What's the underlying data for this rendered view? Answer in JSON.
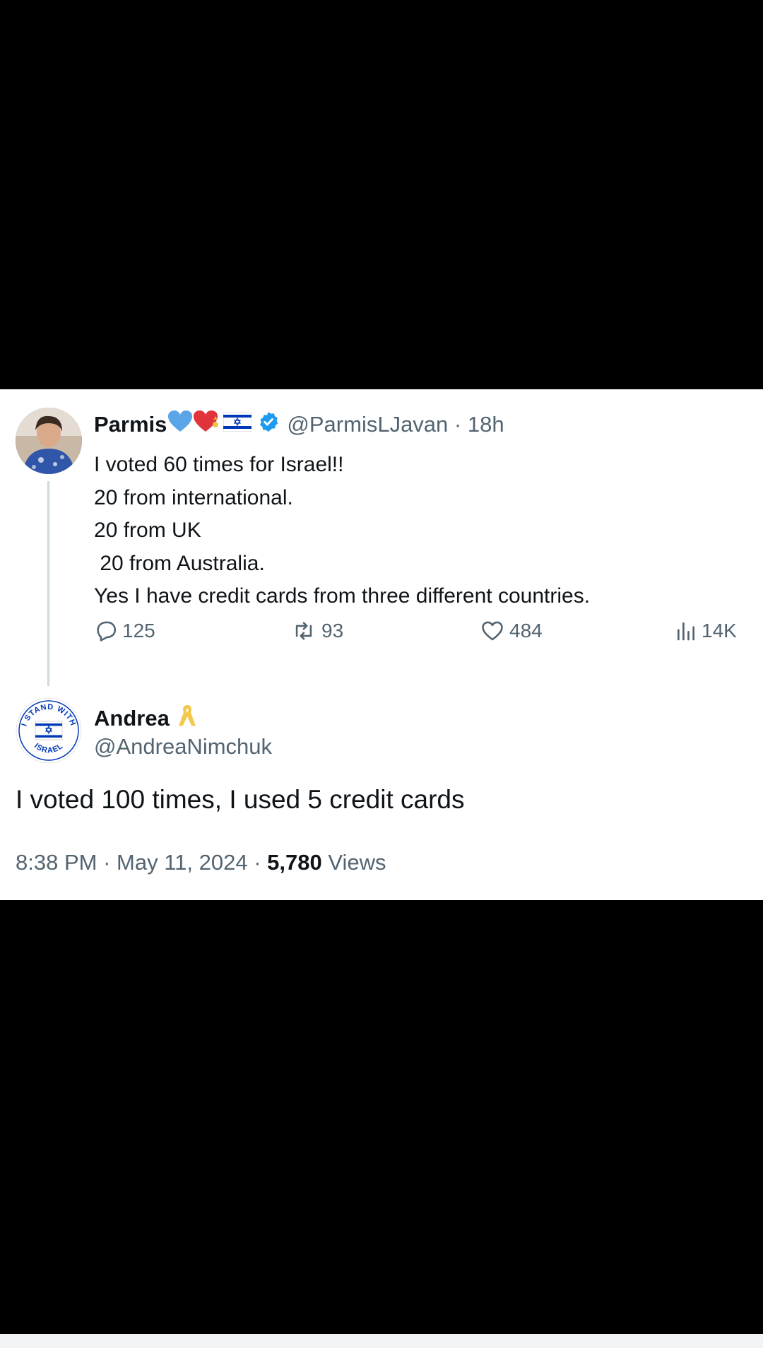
{
  "parent_tweet": {
    "name": "Parmis",
    "emojis": [
      "blue-heart",
      "heart-with-flag",
      "israel-flag"
    ],
    "verified": true,
    "handle": "@ParmisLJavan",
    "time": "18h",
    "separator": "·",
    "lines": [
      "I voted 60 times for Israel!!",
      "20 from international.",
      "20 from UK",
      " 20 from Australia.",
      "Yes I have credit cards from three different countries."
    ],
    "replies": "125",
    "reposts": "93",
    "likes": "484",
    "views": "14K"
  },
  "reply_tweet": {
    "name": "Andrea",
    "badge": "yellow-ribbon",
    "handle": "@AndreaNimchuk",
    "text": "I voted 100 times, I used 5 credit cards",
    "time": "8:38 PM",
    "date": "May 11, 2024",
    "views_count": "5,780",
    "views_label": "Views",
    "separator": "·",
    "avatar_logo_text": {
      "top": "I STAND WITH",
      "bottom": "ISRAEL"
    }
  },
  "colors": {
    "text": "#0f1419",
    "secondary": "#536471",
    "verified": "#1d9bf0",
    "thread_line": "#cfd9de",
    "israel_blue": "#0038b8",
    "ribbon": "#f2c94c"
  }
}
